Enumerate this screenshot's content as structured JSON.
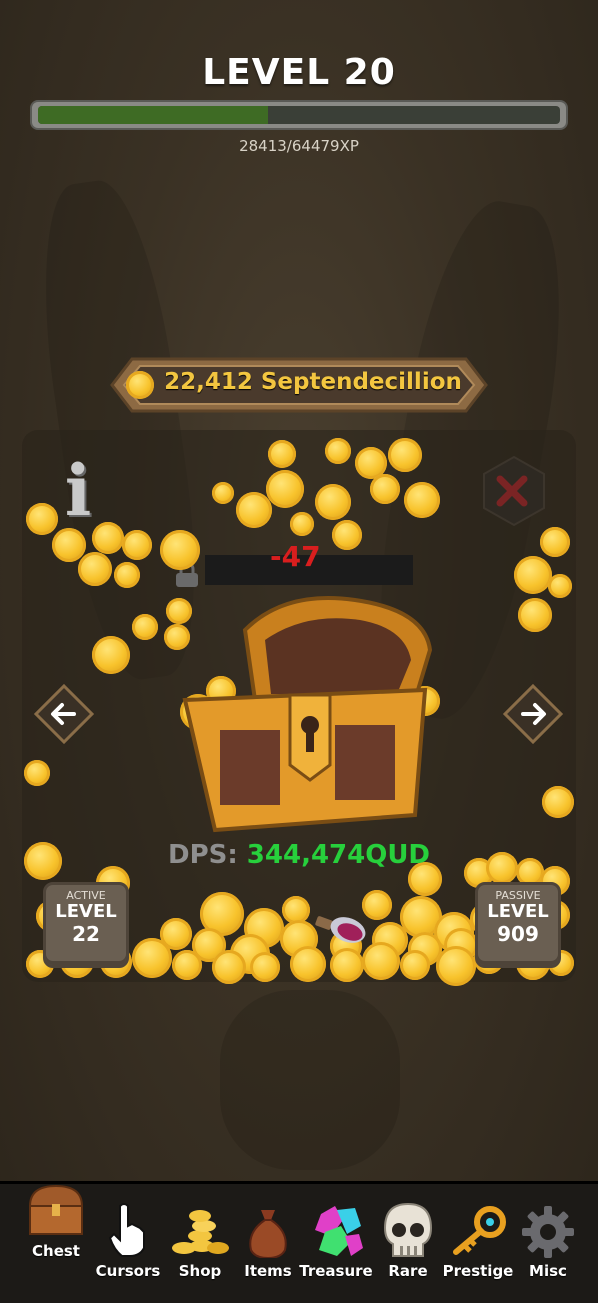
{
  "header": {
    "level_title": "LEVEL 20",
    "xp_text": "28413/64479XP",
    "xp_progress": 0.44
  },
  "currency": {
    "amount_text": "22,412 Septendecillion",
    "icon": "gold-coin-icon"
  },
  "combat": {
    "damage_text": "-47",
    "dps_label": "DPS: ",
    "dps_value": "344,474QUD"
  },
  "badges": {
    "active": {
      "caption": "ACTIVE",
      "label": "LEVEL",
      "value": "22"
    },
    "passive": {
      "caption": "PASSIVE",
      "label": "LEVEL",
      "value": "909"
    }
  },
  "icons": {
    "info": "i",
    "close": "close-icon",
    "left": "arrow-left-icon",
    "right": "arrow-right-icon"
  },
  "tabs": [
    {
      "label": "Chest",
      "icon": "chest-icon"
    },
    {
      "label": "Cursors",
      "icon": "cursor-hand-icon"
    },
    {
      "label": "Shop",
      "icon": "coin-stack-icon"
    },
    {
      "label": "Items",
      "icon": "money-bag-icon"
    },
    {
      "label": "Treasure",
      "icon": "gems-icon"
    },
    {
      "label": "Rare",
      "icon": "skull-icon"
    },
    {
      "label": "Prestige",
      "icon": "key-icon"
    },
    {
      "label": "Misc",
      "icon": "gear-icon"
    }
  ],
  "colors": {
    "xp_fill": "#3e6b24",
    "currency_text": "#f3c640",
    "dps_value": "#27d03c",
    "damage": "#d91e1e"
  }
}
